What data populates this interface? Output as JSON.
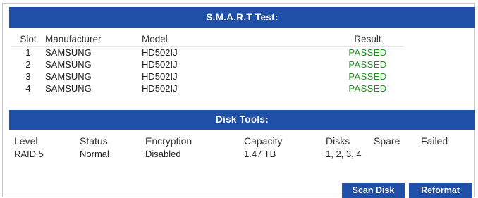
{
  "smart": {
    "title": "S.M.A.R.T Test:",
    "headers": {
      "slot": "Slot",
      "manufacturer": "Manufacturer",
      "model": "Model",
      "result": "Result"
    },
    "rows": [
      {
        "slot": "1",
        "manufacturer": "SAMSUNG",
        "model": "HD502IJ",
        "result": "PASSED"
      },
      {
        "slot": "2",
        "manufacturer": "SAMSUNG",
        "model": "HD502IJ",
        "result": "PASSED"
      },
      {
        "slot": "3",
        "manufacturer": "SAMSUNG",
        "model": "HD502IJ",
        "result": "PASSED"
      },
      {
        "slot": "4",
        "manufacturer": "SAMSUNG",
        "model": "HD502IJ",
        "result": "PASSED"
      }
    ]
  },
  "disk_tools": {
    "title": "Disk Tools:",
    "headers": {
      "level": "Level",
      "status": "Status",
      "encryption": "Encryption",
      "capacity": "Capacity",
      "disks": "Disks",
      "spare": "Spare",
      "failed": "Failed"
    },
    "rows": [
      {
        "level": "RAID 5",
        "status": "Normal",
        "encryption": "Disabled",
        "capacity": "1.47 TB",
        "disks": "1, 2, 3, 4",
        "spare": "",
        "failed": ""
      }
    ],
    "buttons": {
      "scan_disk": "Scan Disk",
      "reformat": "Reformat"
    }
  },
  "colors": {
    "header_bar": "#1f4fa6",
    "passed": "#1f8f1f"
  }
}
